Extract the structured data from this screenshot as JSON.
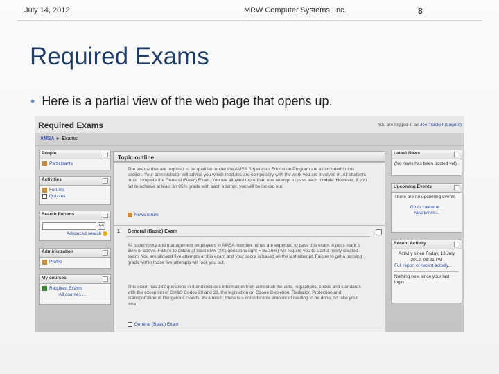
{
  "slide": {
    "date": "July 14, 2012",
    "company": "MRW Computer Systems, Inc.",
    "page_number": "8",
    "title": "Required Exams",
    "bullet": "Here is a partial view of the web page that opens up."
  },
  "screenshot": {
    "title": "Required Exams",
    "login_prefix": "You are logged in as ",
    "login_user": "Joe Tracker",
    "login_action": "(Logout)",
    "breadcrumb": [
      "AMSA",
      "Exams"
    ],
    "left_blocks": {
      "people": {
        "title": "People",
        "items": [
          "Participants"
        ]
      },
      "activities": {
        "title": "Activities",
        "items": [
          "Forums",
          "Quizzes"
        ]
      },
      "search": {
        "title": "Search Forums",
        "go_label": "Go",
        "advanced": "Advanced search"
      },
      "administration": {
        "title": "Administration",
        "items": [
          "Profile"
        ]
      },
      "my_courses": {
        "title": "My courses",
        "items": [
          "Required Exams"
        ],
        "all": "All courses ..."
      }
    },
    "topic": {
      "heading": "Topic outline",
      "intro": "The exams that are required to be qualified under the AMSA Supervisor Education Program are all included in this section. Your administrator will advise you which modules are compulsory with the work you are involved in. All students must complete the General (Basic) Exam. You are allowed more than one attempt to pass each module. However, if you fail to achieve at least an 85% grade with each attempt, you will be locked out.",
      "news_forum": "News forum",
      "section_number": "1",
      "section_title": "General (Basic) Exam",
      "para1": "All supervisory and management employees in AMSA member mines are expected to pass this exam. A pass mark is 85% or above. Failure to obtain at least 85% (241 questions right = 85.16%) will require you to start a newly created exam. You are allowed five attempts at this exam and your score is based on the last attempt. Failure to get a passing grade within those five attempts will lock you out.",
      "para2": "This exam has 283 questions in it and includes information from almost all the acts, regulations, codes and standards with the exception of OH&S Codes 20 and 23, the legislation on Ozone Depletion, Radiation Protection and Transportation of Dangerous Goods. As a result, there is a considerable amount of reading to be done, so take your time.",
      "exam_link": "General (Basic) Exam"
    },
    "right_blocks": {
      "latest_news": {
        "title": "Latest News",
        "body": "(No news has been posted yet)"
      },
      "upcoming": {
        "title": "Upcoming Events",
        "body": "There are no upcoming events",
        "goto": "Go to calendar...",
        "new_event": "New Event..."
      },
      "recent": {
        "title": "Recent Activity",
        "since": "Activity since Friday, 13 July 2012, 06:21 PM",
        "full_report": "Full report of recent activity...",
        "nothing": "Nothing new since your last login"
      }
    }
  }
}
